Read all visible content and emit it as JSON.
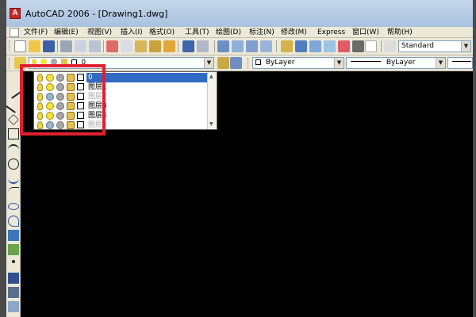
{
  "window": {
    "title": "AutoCAD 2006 - [Drawing1.dwg]",
    "app_icon_letter": "A"
  },
  "menu": {
    "items": [
      {
        "label": "文件(F)"
      },
      {
        "label": "编辑(E)"
      },
      {
        "label": "视图(V)"
      },
      {
        "label": "插入(I)"
      },
      {
        "label": "格式(O)"
      },
      {
        "label": "工具(T)"
      },
      {
        "label": "绘图(D)"
      },
      {
        "label": "标注(N)"
      },
      {
        "label": "修改(M)"
      },
      {
        "label": "Express"
      },
      {
        "label": "窗口(W)"
      },
      {
        "label": "帮助(H)"
      }
    ]
  },
  "styles": {
    "text_style": "Standard"
  },
  "properties": {
    "layer_current": "0",
    "color": "ByLayer",
    "linetype": "ByLayer",
    "lineweight": "ByLayer"
  },
  "layers": [
    {
      "name": "0",
      "frozen": false,
      "selected": true,
      "dim": false
    },
    {
      "name": "图层1",
      "frozen": false,
      "selected": false,
      "dim": false
    },
    {
      "name": "图层2",
      "frozen": true,
      "selected": false,
      "dim": true
    },
    {
      "name": "图层3",
      "frozen": false,
      "selected": false,
      "dim": false
    },
    {
      "name": "图层4",
      "frozen": false,
      "selected": false,
      "dim": false
    },
    {
      "name": "图层5",
      "frozen": true,
      "selected": false,
      "dim": true
    }
  ],
  "colors": {
    "highlight": "#e02030",
    "selection": "#316ac5",
    "canvas": "#000000"
  }
}
